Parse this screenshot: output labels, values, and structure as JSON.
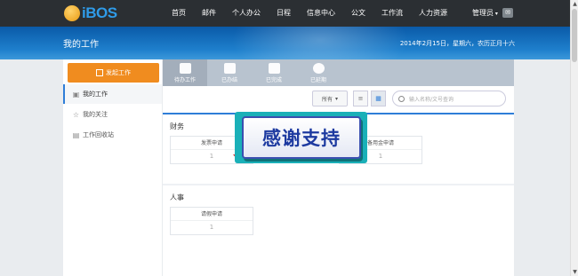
{
  "header": {
    "logo_text": "iBOS",
    "nav": [
      "首页",
      "邮件",
      "个人办公",
      "日程",
      "信息中心",
      "公文",
      "工作流",
      "人力资源"
    ],
    "user": "管理员",
    "mail_icon": "mail-icon"
  },
  "banner": {
    "title": "我的工作",
    "date": "2014年2月15日，星期六，农历正月十六"
  },
  "sidebar": {
    "launch_label": "发起工作",
    "items": [
      {
        "label": "我的工作",
        "icon": "briefcase-icon"
      },
      {
        "label": "我的关注",
        "icon": "star-icon"
      },
      {
        "label": "工作回收站",
        "icon": "trash-icon"
      }
    ]
  },
  "tabs": [
    {
      "label": "待办工作",
      "icon": "briefcase-icon"
    },
    {
      "label": "已办结",
      "icon": "document-icon"
    },
    {
      "label": "已完成",
      "icon": "checklist-icon"
    },
    {
      "label": "已延期",
      "icon": "pause-icon"
    }
  ],
  "toolbar": {
    "filter_value": "所有",
    "search_placeholder": "输入名称/文号查询"
  },
  "sections": [
    {
      "title": "财务",
      "cards": [
        {
          "name": "发票申请",
          "count": "1"
        },
        {
          "name": "备用金申请",
          "count": "1"
        }
      ]
    },
    {
      "title": "人事",
      "cards": [
        {
          "name": "请假申请",
          "count": "1"
        }
      ]
    }
  ],
  "overlay": {
    "text": "感谢支持"
  }
}
